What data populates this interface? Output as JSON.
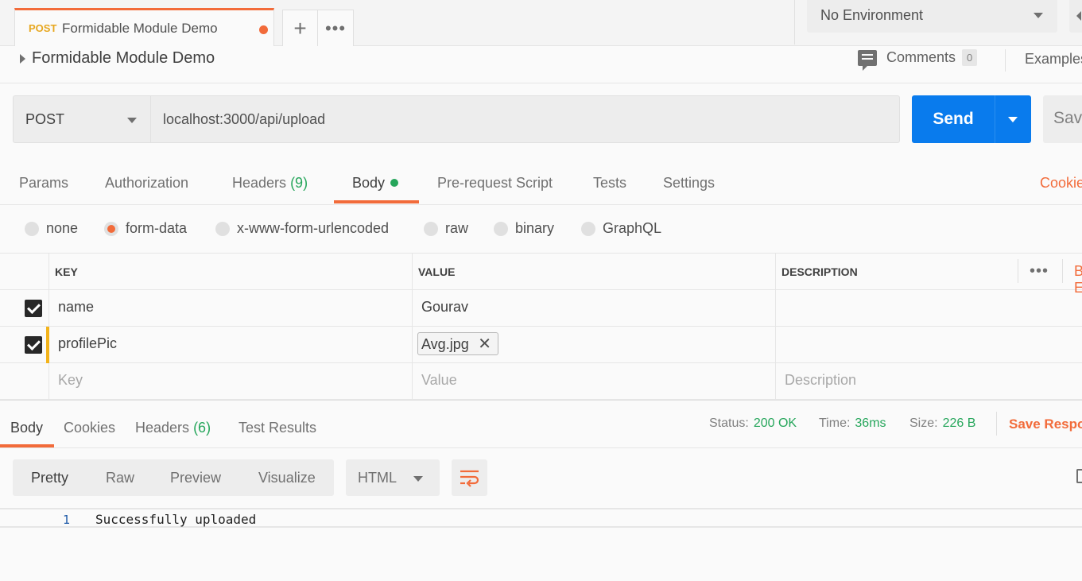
{
  "tab": {
    "method": "POST",
    "name": "Formidable Module Demo"
  },
  "environment": {
    "selected": "No Environment"
  },
  "request": {
    "title": "Formidable Module Demo",
    "comments_label": "Comments",
    "comments_count": "0",
    "examples_label": "Examples",
    "method": "POST",
    "url": "localhost:3000/api/upload",
    "send_label": "Send",
    "save_label": "Save"
  },
  "request_tabs": {
    "params": "Params",
    "authorization": "Authorization",
    "headers": "Headers",
    "headers_count": "(9)",
    "body": "Body",
    "pre_request": "Pre-request Script",
    "tests": "Tests",
    "settings": "Settings",
    "cookies": "Cookies"
  },
  "body_types": [
    "none",
    "form-data",
    "x-www-form-urlencoded",
    "raw",
    "binary",
    "GraphQL"
  ],
  "body_type_selected": "form-data",
  "params_table": {
    "headers": [
      "KEY",
      "VALUE",
      "DESCRIPTION"
    ],
    "bulk_edit": "Bulk Edit",
    "rows": [
      {
        "key": "name",
        "value": "Gourav",
        "checked": true
      },
      {
        "key": "profilePic",
        "value": "Avg.jpg",
        "checked": true
      }
    ],
    "placeholders": {
      "key": "Key",
      "value": "Value",
      "description": "Description"
    }
  },
  "response_tabs": {
    "body": "Body",
    "cookies": "Cookies",
    "headers": "Headers",
    "headers_count": "(6)",
    "test_results": "Test Results"
  },
  "response_status": {
    "status_label": "Status:",
    "status_value": "200 OK",
    "time_label": "Time:",
    "time_value": "36ms",
    "size_label": "Size:",
    "size_value": "226 B",
    "save_response": "Save Response"
  },
  "response_view": {
    "formats": [
      "Pretty",
      "Raw",
      "Preview",
      "Visualize"
    ],
    "selected_format": "Pretty",
    "language": "HTML",
    "line_number": "1",
    "body_text": "Successfully uploaded"
  },
  "colors": {
    "accent": "#f26b3a",
    "send_blue": "#097bed",
    "success_green": "#26a65b",
    "post_method": "#e7a71f"
  }
}
